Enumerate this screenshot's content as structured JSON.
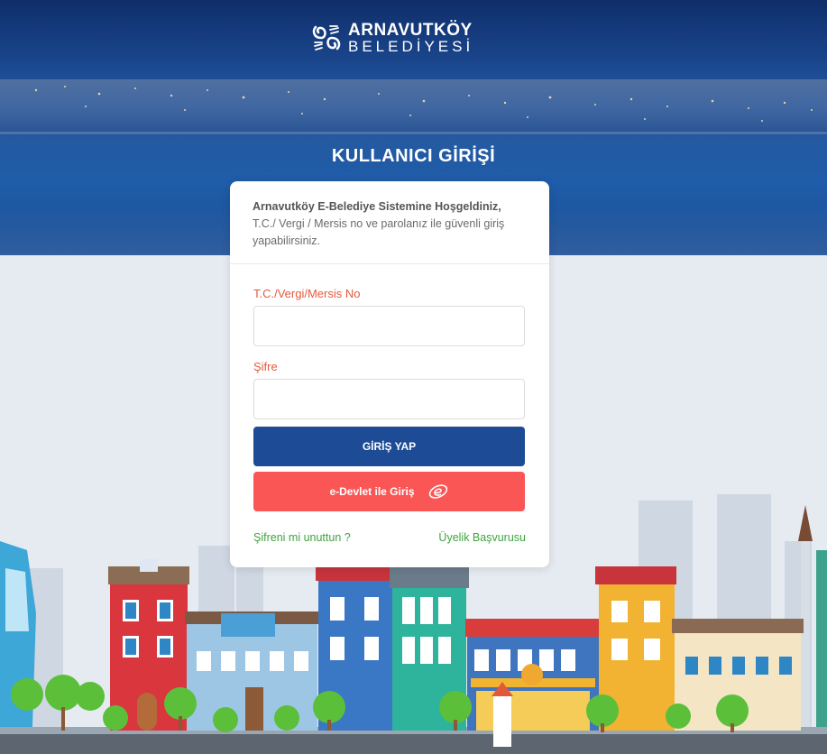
{
  "header": {
    "brand_line1": "ARNAVUTKÖY",
    "brand_line2": "BELEDİYESİ",
    "page_title": "KULLANICI GİRİŞİ"
  },
  "login": {
    "welcome_bold": "Arnavutköy E-Belediye Sistemine Hoşgeldiniz,",
    "welcome_text": "T.C./ Vergi / Mersis no ve parolanız ile güvenli giriş yapabilirsiniz.",
    "id_label": "T.C./Vergi/Mersis No",
    "id_value": "",
    "password_label": "Şifre",
    "password_value": "",
    "login_button": "GİRİŞ YAP",
    "edevlet_button": "e-Devlet ile Giriş",
    "forgot_link": "Şifreni mi unuttun ?",
    "register_link": "Üyelik Başvurusu"
  },
  "colors": {
    "header_blue": "#1c4a92",
    "label_orange": "#e45a3c",
    "login_button": "#1d4b95",
    "edevlet_button": "#fb5656",
    "link_green": "#3fa43f"
  },
  "icons": {
    "logo": "arnavutkoy-logo-icon",
    "edevlet": "edevlet-logo-icon"
  }
}
